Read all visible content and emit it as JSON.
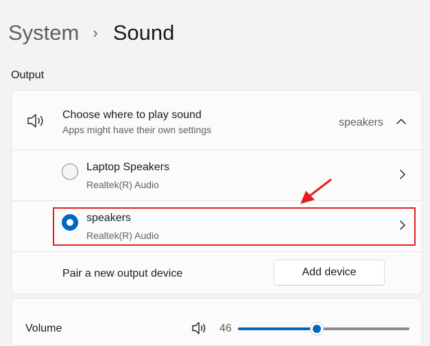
{
  "breadcrumb": {
    "parent": "System",
    "separator": "›",
    "current": "Sound"
  },
  "output": {
    "section_label": "Output",
    "choose": {
      "title": "Choose where to play sound",
      "subtitle": "Apps might have their own settings",
      "value": "speakers",
      "icon": "speaker-icon",
      "expand_icon": "chevron-up-icon"
    },
    "devices": [
      {
        "name": "Laptop Speakers",
        "driver": "Realtek(R) Audio",
        "selected": false
      },
      {
        "name": "speakers",
        "driver": "Realtek(R) Audio",
        "selected": true
      }
    ],
    "pair": {
      "label": "Pair a new output device",
      "button": "Add device"
    }
  },
  "volume": {
    "label": "Volume",
    "value": "46",
    "level": 0.46,
    "icon": "speaker-icon"
  },
  "colors": {
    "accent": "#0067c0",
    "annotation": "#e02020"
  }
}
